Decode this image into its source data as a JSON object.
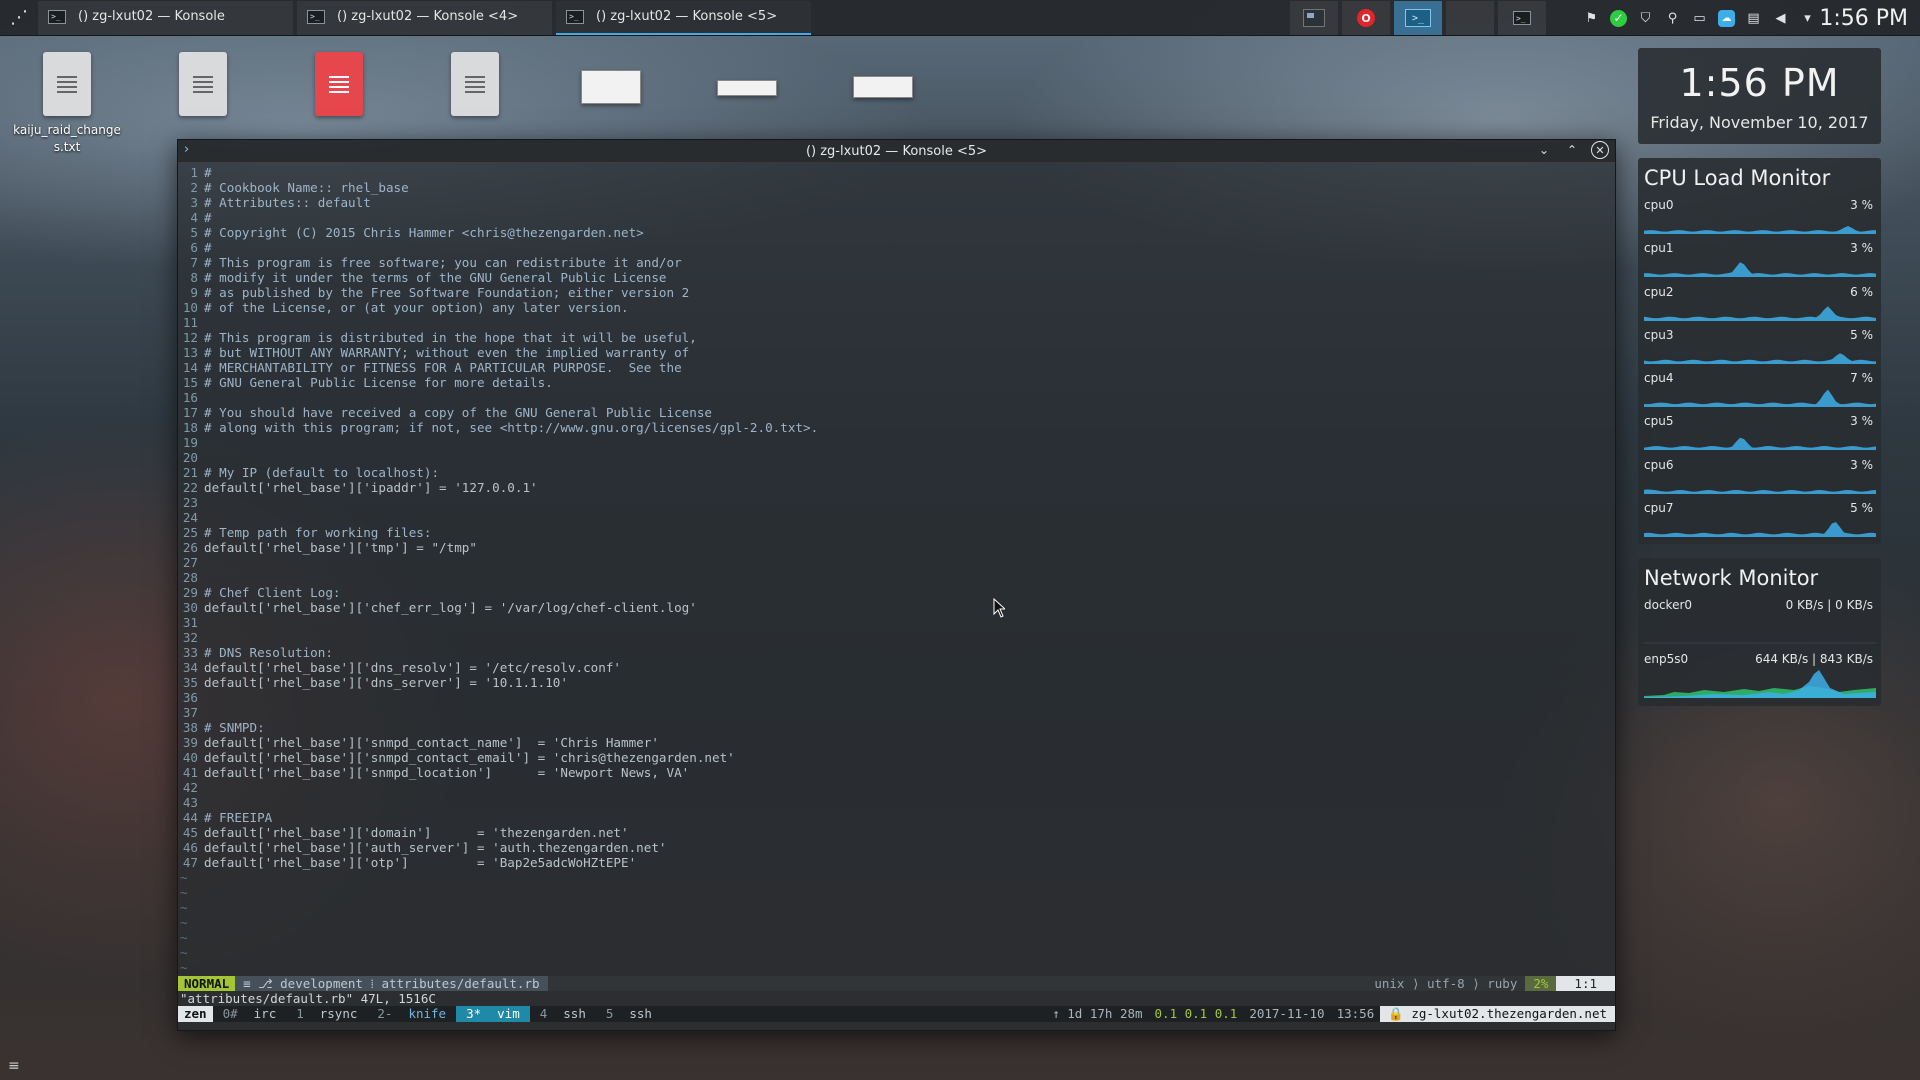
{
  "taskbar": {
    "tasks": [
      {
        "label": "() zg-lxut02 — Konsole"
      },
      {
        "label": "() zg-lxut02 — Konsole <4>"
      },
      {
        "label": "() zg-lxut02 — Konsole <5>"
      }
    ],
    "clock": "1:56 PM"
  },
  "desktop": {
    "icons": [
      {
        "label": "kaiju_raid_changes.txt"
      }
    ]
  },
  "window": {
    "title": "() zg-lxut02 — Konsole <5>"
  },
  "editor": {
    "lines": [
      "#",
      "# Cookbook Name:: rhel_base",
      "# Attributes:: default",
      "#",
      "# Copyright (C) 2015 Chris Hammer <chris@thezengarden.net>",
      "#",
      "# This program is free software; you can redistribute it and/or",
      "# modify it under the terms of the GNU General Public License",
      "# as published by the Free Software Foundation; either version 2",
      "# of the License, or (at your option) any later version.",
      "",
      "# This program is distributed in the hope that it will be useful,",
      "# but WITHOUT ANY WARRANTY; without even the implied warranty of",
      "# MERCHANTABILITY or FITNESS FOR A PARTICULAR PURPOSE.  See the",
      "# GNU General Public License for more details.",
      "",
      "# You should have received a copy of the GNU General Public License",
      "# along with this program; if not, see <http://www.gnu.org/licenses/gpl-2.0.txt>.",
      "",
      "",
      "# My IP (default to localhost):",
      "default['rhel_base']['ipaddr'] = '127.0.0.1'",
      "",
      "",
      "# Temp path for working files:",
      "default['rhel_base']['tmp'] = \"/tmp\"",
      "",
      "",
      "# Chef Client Log:",
      "default['rhel_base']['chef_err_log'] = '/var/log/chef-client.log'",
      "",
      "",
      "# DNS Resolution:",
      "default['rhel_base']['dns_resolv'] = '/etc/resolv.conf'",
      "default['rhel_base']['dns_server'] = '10.1.1.10'",
      "",
      "",
      "# SNMPD:",
      "default['rhel_base']['snmpd_contact_name']  = 'Chris Hammer'",
      "default['rhel_base']['snmpd_contact_email'] = 'chris@thezengarden.net'",
      "default['rhel_base']['snmpd_location']      = 'Newport News, VA'",
      "",
      "",
      "# FREEIPA",
      "default['rhel_base']['domain']      = 'thezengarden.net'",
      "default['rhel_base']['auth_server'] = 'auth.thezengarden.net'",
      "default['rhel_base']['otp']         = 'Bap2e5adcWoHZtEPE'"
    ],
    "tilde": "~"
  },
  "statusline": {
    "mode": "NORMAL",
    "branch": "development",
    "path": "attributes/default.rb",
    "fileformat": "unix",
    "encoding": "utf-8",
    "filetype": "ruby",
    "percent": "2%",
    "position": "1:1"
  },
  "message": "\"attributes/default.rb\" 47L, 1516C",
  "tmux": {
    "session": "zen",
    "windows": [
      {
        "num": "0#",
        "name": "irc"
      },
      {
        "num": "1",
        "name": "rsync"
      },
      {
        "num": "2-",
        "name": "knife"
      },
      {
        "num": "3*",
        "name": "vim"
      },
      {
        "num": "4",
        "name": "ssh"
      },
      {
        "num": "5",
        "name": "ssh"
      }
    ],
    "uptime": "1d 17h 28m",
    "load": "0.1 0.1 0.1",
    "date": "2017-11-10",
    "time": "13:56",
    "host": "zg-lxut02.thezengarden.net"
  },
  "clock_widget": {
    "time": "1:56 PM",
    "date": "Friday, November 10, 2017"
  },
  "cpu_monitor": {
    "title": "CPU Load Monitor",
    "cpus": [
      {
        "name": "cpu0",
        "value": "3 %",
        "pct": 3
      },
      {
        "name": "cpu1",
        "value": "3 %",
        "pct": 3
      },
      {
        "name": "cpu2",
        "value": "6 %",
        "pct": 6
      },
      {
        "name": "cpu3",
        "value": "5 %",
        "pct": 5
      },
      {
        "name": "cpu4",
        "value": "7 %",
        "pct": 7
      },
      {
        "name": "cpu5",
        "value": "3 %",
        "pct": 3
      },
      {
        "name": "cpu6",
        "value": "3 %",
        "pct": 3
      },
      {
        "name": "cpu7",
        "value": "5 %",
        "pct": 5
      }
    ]
  },
  "network_monitor": {
    "title": "Network Monitor",
    "interfaces": [
      {
        "name": "docker0",
        "down": "0 KB/s",
        "up": "0 KB/s"
      },
      {
        "name": "enp5s0",
        "down": "644 KB/s",
        "up": "843 KB/s"
      }
    ]
  },
  "colors": {
    "accent": "#3daee9",
    "vim_mode": "#a4c635",
    "graph": "#3daee9",
    "graph_up": "#2ecc71"
  }
}
